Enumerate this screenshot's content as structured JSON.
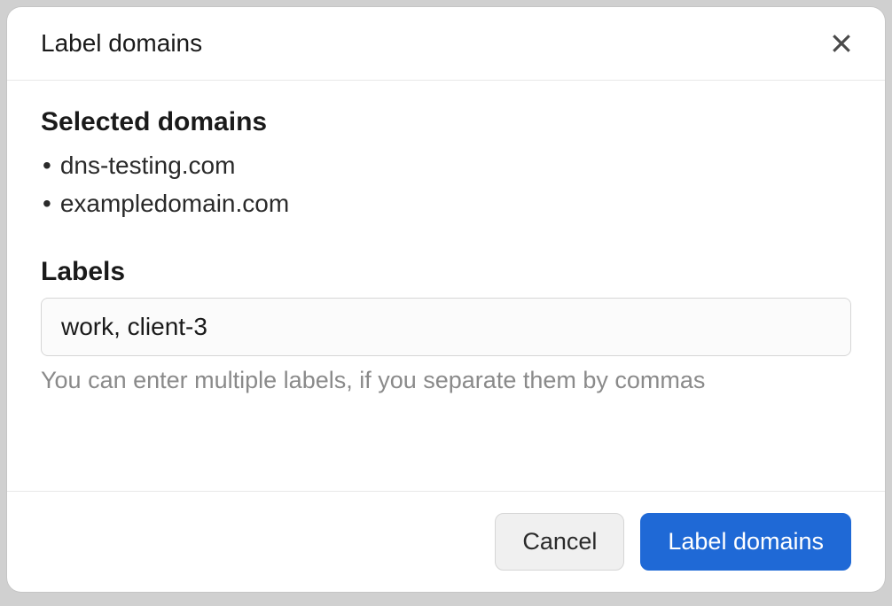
{
  "modal": {
    "title": "Label domains",
    "selected_domains_heading": "Selected domains",
    "domains": [
      "dns-testing.com",
      "exampledomain.com"
    ],
    "labels_heading": "Labels",
    "labels_value": "work, client-3",
    "labels_helper": "You can enter multiple labels, if you separate them by commas",
    "cancel_label": "Cancel",
    "submit_label": "Label domains"
  }
}
